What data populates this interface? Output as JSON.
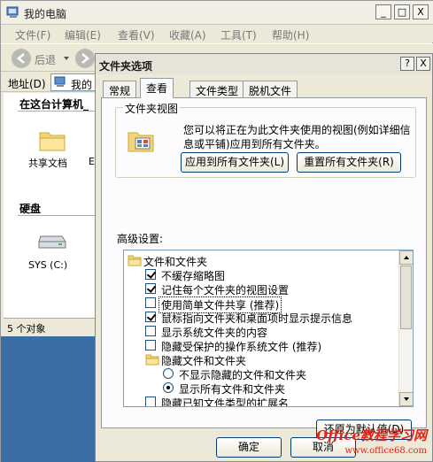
{
  "explorer": {
    "title": "我的电脑",
    "window_controls": {
      "minimize": "_",
      "maximize": "□",
      "close": "X"
    },
    "menu": [
      "文件(F)",
      "编辑(E)",
      "查看(V)",
      "收藏(A)",
      "工具(T)",
      "帮助(H)"
    ],
    "toolbar": {
      "back_label": "后退"
    },
    "address": {
      "label": "地址(D)",
      "value": "我的"
    },
    "groups": {
      "stored": "在这台计算机_",
      "drives": "硬盘"
    },
    "items": {
      "shared_docs": "共享文档",
      "shared_docs_peek": "E",
      "drive_c": "SYS (C:)"
    },
    "status": "5 个对象"
  },
  "dialog": {
    "title": "文件夹选项",
    "help_button": "?",
    "close_button": "X",
    "tabs": [
      "常规",
      "查看",
      "文件类型",
      "脱机文件"
    ],
    "active_tab": "查看",
    "folder_views": {
      "legend": "文件夹视图",
      "description": "您可以将正在为此文件夹使用的视图(例如详细信息或平铺)应用到所有文件夹。",
      "apply_all_label": "应用到所有文件夹(L)",
      "reset_all_label": "重置所有文件夹(R)"
    },
    "advanced": {
      "label": "高级设置:",
      "tree": [
        {
          "kind": "folder",
          "indent": 0,
          "label": "文件和文件夹"
        },
        {
          "kind": "checkbox",
          "indent": 1,
          "label": "不缓存缩略图",
          "checked": true
        },
        {
          "kind": "checkbox",
          "indent": 1,
          "label": "记住每个文件夹的视图设置",
          "checked": true
        },
        {
          "kind": "checkbox",
          "indent": 1,
          "label": "使用简单文件共享 (推荐)",
          "checked": false,
          "focused": true
        },
        {
          "kind": "checkbox",
          "indent": 1,
          "label": "鼠标指向文件夹和桌面项时显示提示信息",
          "checked": true
        },
        {
          "kind": "checkbox",
          "indent": 1,
          "label": "显示系统文件夹的内容",
          "checked": false
        },
        {
          "kind": "checkbox",
          "indent": 1,
          "label": "隐藏受保护的操作系统文件 (推荐)",
          "checked": false
        },
        {
          "kind": "folder",
          "indent": 1,
          "label": "隐藏文件和文件夹"
        },
        {
          "kind": "radio",
          "indent": 2,
          "label": "不显示隐藏的文件和文件夹",
          "checked": false
        },
        {
          "kind": "radio",
          "indent": 2,
          "label": "显示所有文件和文件夹",
          "checked": true
        },
        {
          "kind": "checkbox",
          "indent": 1,
          "label": "隐藏已知文件类型的扩展名",
          "checked": false
        }
      ]
    },
    "restore_defaults_label": "还原为默认值(D)",
    "ok_label": "确定",
    "cancel_label": "取消"
  },
  "watermark": {
    "line1": "Office教程学习网",
    "line2": "www.office68.com"
  }
}
